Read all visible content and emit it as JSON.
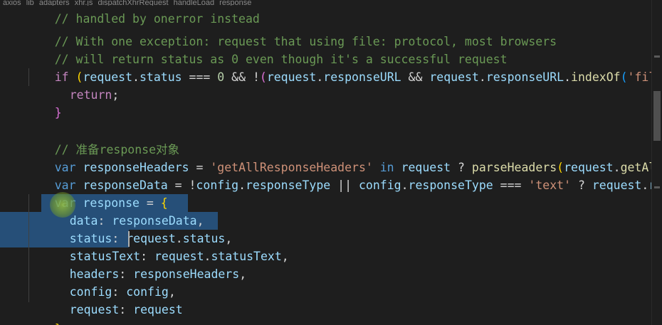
{
  "breadcrumb": {
    "items": [
      "axios",
      "lib",
      "adapters",
      "xhr.js",
      "dispatchXhrRequest",
      "handleLoad",
      "response"
    ]
  },
  "code": {
    "line1": "// handled by onerror instead",
    "line2": "// With one exception: request that using file: protocol, most browsers",
    "line3": "// will return status as 0 even though it's a successful request",
    "line4": {
      "if": "if",
      "p1": " (",
      "req1": "request",
      "dot1": ".",
      "status": "status",
      "op1": " === ",
      "zero": "0",
      "op2": " && !",
      "p2": "(",
      "req2": "request",
      "dot2": ".",
      "respurl1": "responseURL",
      "op3": " && ",
      "req3": "request",
      "dot3": ".",
      "respurl2": "responseURL",
      "dot4": ".",
      "indexOf": "indexOf",
      "p3": "(",
      "filestr": "'file:"
    },
    "line5": {
      "ret": "return",
      "semi": ";"
    },
    "line6": "}",
    "line8": "// 准备response对象",
    "line9": {
      "var": "var",
      "name": " responseHeaders",
      "eq": " = ",
      "str": "'getAllResponseHeaders'",
      "in": " in ",
      "req": "request",
      "q": " ? ",
      "fn": "parseHeaders",
      "p": "(",
      "req2": "request",
      "dot": ".",
      "tail": "getAllR"
    },
    "line10": {
      "var": "var",
      "name": " responseData",
      "eq": " = !",
      "cfg": "config",
      "dot": ".",
      "rt": "responseType",
      "or": " || ",
      "cfg2": "config",
      "dot2": ".",
      "rt2": "responseType",
      "eq3": " === ",
      "str": "'text'",
      "q": " ? ",
      "req": "request",
      "dot3": ".",
      "tail": "res"
    },
    "line11": {
      "var": "var",
      "name": " response",
      "eq": " = ",
      "brace": "{"
    },
    "line12": {
      "key": "data",
      "colon": ": ",
      "val": "responseData",
      "comma": ","
    },
    "line13": {
      "key": "status",
      "colon": ": ",
      "obj": "request",
      "dot": ".",
      "prop": "status",
      "comma": ","
    },
    "line14": {
      "key": "statusText",
      "colon": ": ",
      "obj": "request",
      "dot": ".",
      "prop": "statusText",
      "comma": ","
    },
    "line15": {
      "key": "headers",
      "colon": ": ",
      "val": "responseHeaders",
      "comma": ","
    },
    "line16": {
      "key": "config",
      "colon": ": ",
      "val": "config",
      "comma": ","
    },
    "line17": {
      "key": "request",
      "colon": ": ",
      "val": "request"
    },
    "line18": {
      "brace": "}",
      "semi": ";"
    }
  },
  "colors": {
    "background": "#1e1e1e",
    "selection": "#264f78",
    "keyword": "#569cd6",
    "control": "#c586c0",
    "variable": "#9cdcfe",
    "function": "#dcdcaa",
    "string": "#ce9178",
    "number": "#b5cea8",
    "comment": "#6a9955"
  }
}
